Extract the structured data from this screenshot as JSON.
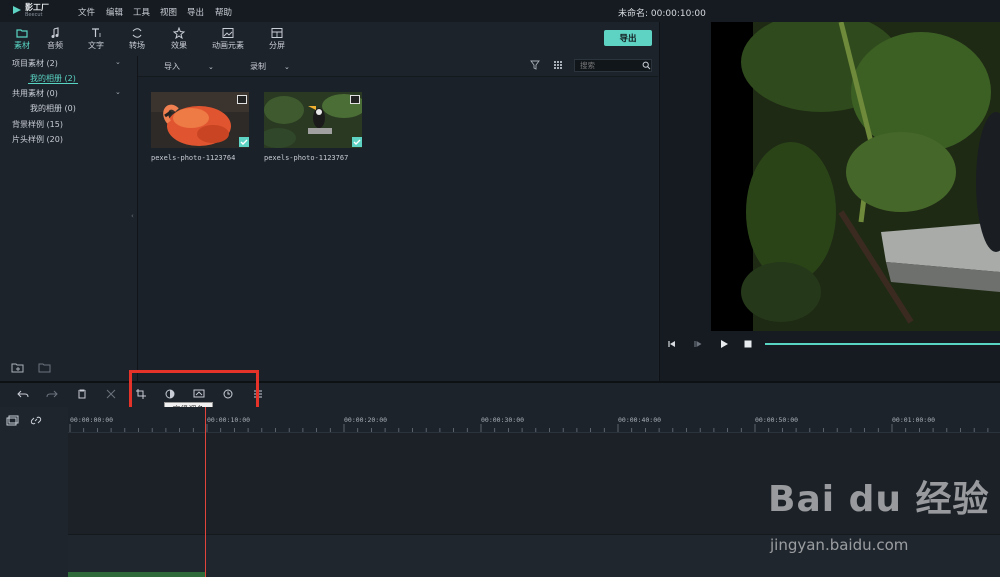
{
  "app": {
    "logo_name": "影工厂",
    "logo_sub": "Beecut",
    "project_title": "未命名: 00:00:10:00",
    "accent_color": "#5fd3c3"
  },
  "menu": [
    "文件",
    "编辑",
    "工具",
    "视图",
    "导出",
    "帮助"
  ],
  "toolbar": {
    "tabs": [
      {
        "label": "素材",
        "icon": "folder-icon"
      },
      {
        "label": "音频",
        "icon": "music-note-icon"
      },
      {
        "label": "文字",
        "icon": "text-icon"
      },
      {
        "label": "转场",
        "icon": "transition-icon"
      },
      {
        "label": "效果",
        "icon": "effects-icon"
      },
      {
        "label": "动画元素",
        "icon": "image-icon"
      },
      {
        "label": "分屏",
        "icon": "split-screen-icon"
      }
    ],
    "export_label": "导出"
  },
  "tree": {
    "items": [
      {
        "label": "项目素材 (2)"
      },
      {
        "label": "我的相册 (2)"
      },
      {
        "label": "共用素材 (0)"
      },
      {
        "label": "我的相册 (0)"
      },
      {
        "label": "背景样例 (15)"
      },
      {
        "label": "片头样例 (20)"
      }
    ]
  },
  "media": {
    "import_label": "导入",
    "record_label": "录制",
    "search_placeholder": "搜索",
    "files": [
      {
        "name": "pexels-photo-1123764"
      },
      {
        "name": "pexels-photo-1123767"
      }
    ]
  },
  "timeline": {
    "tooltip": "高级调色",
    "ruler": [
      "00:00:00:00",
      "00:00:10:00",
      "00:00:20:00",
      "00:00:30:00",
      "00:00:40:00",
      "00:00:50:00",
      "00:01:00:00"
    ]
  },
  "watermark": {
    "text": "Bai du 经验",
    "sub": "jingyan.baidu.com"
  }
}
